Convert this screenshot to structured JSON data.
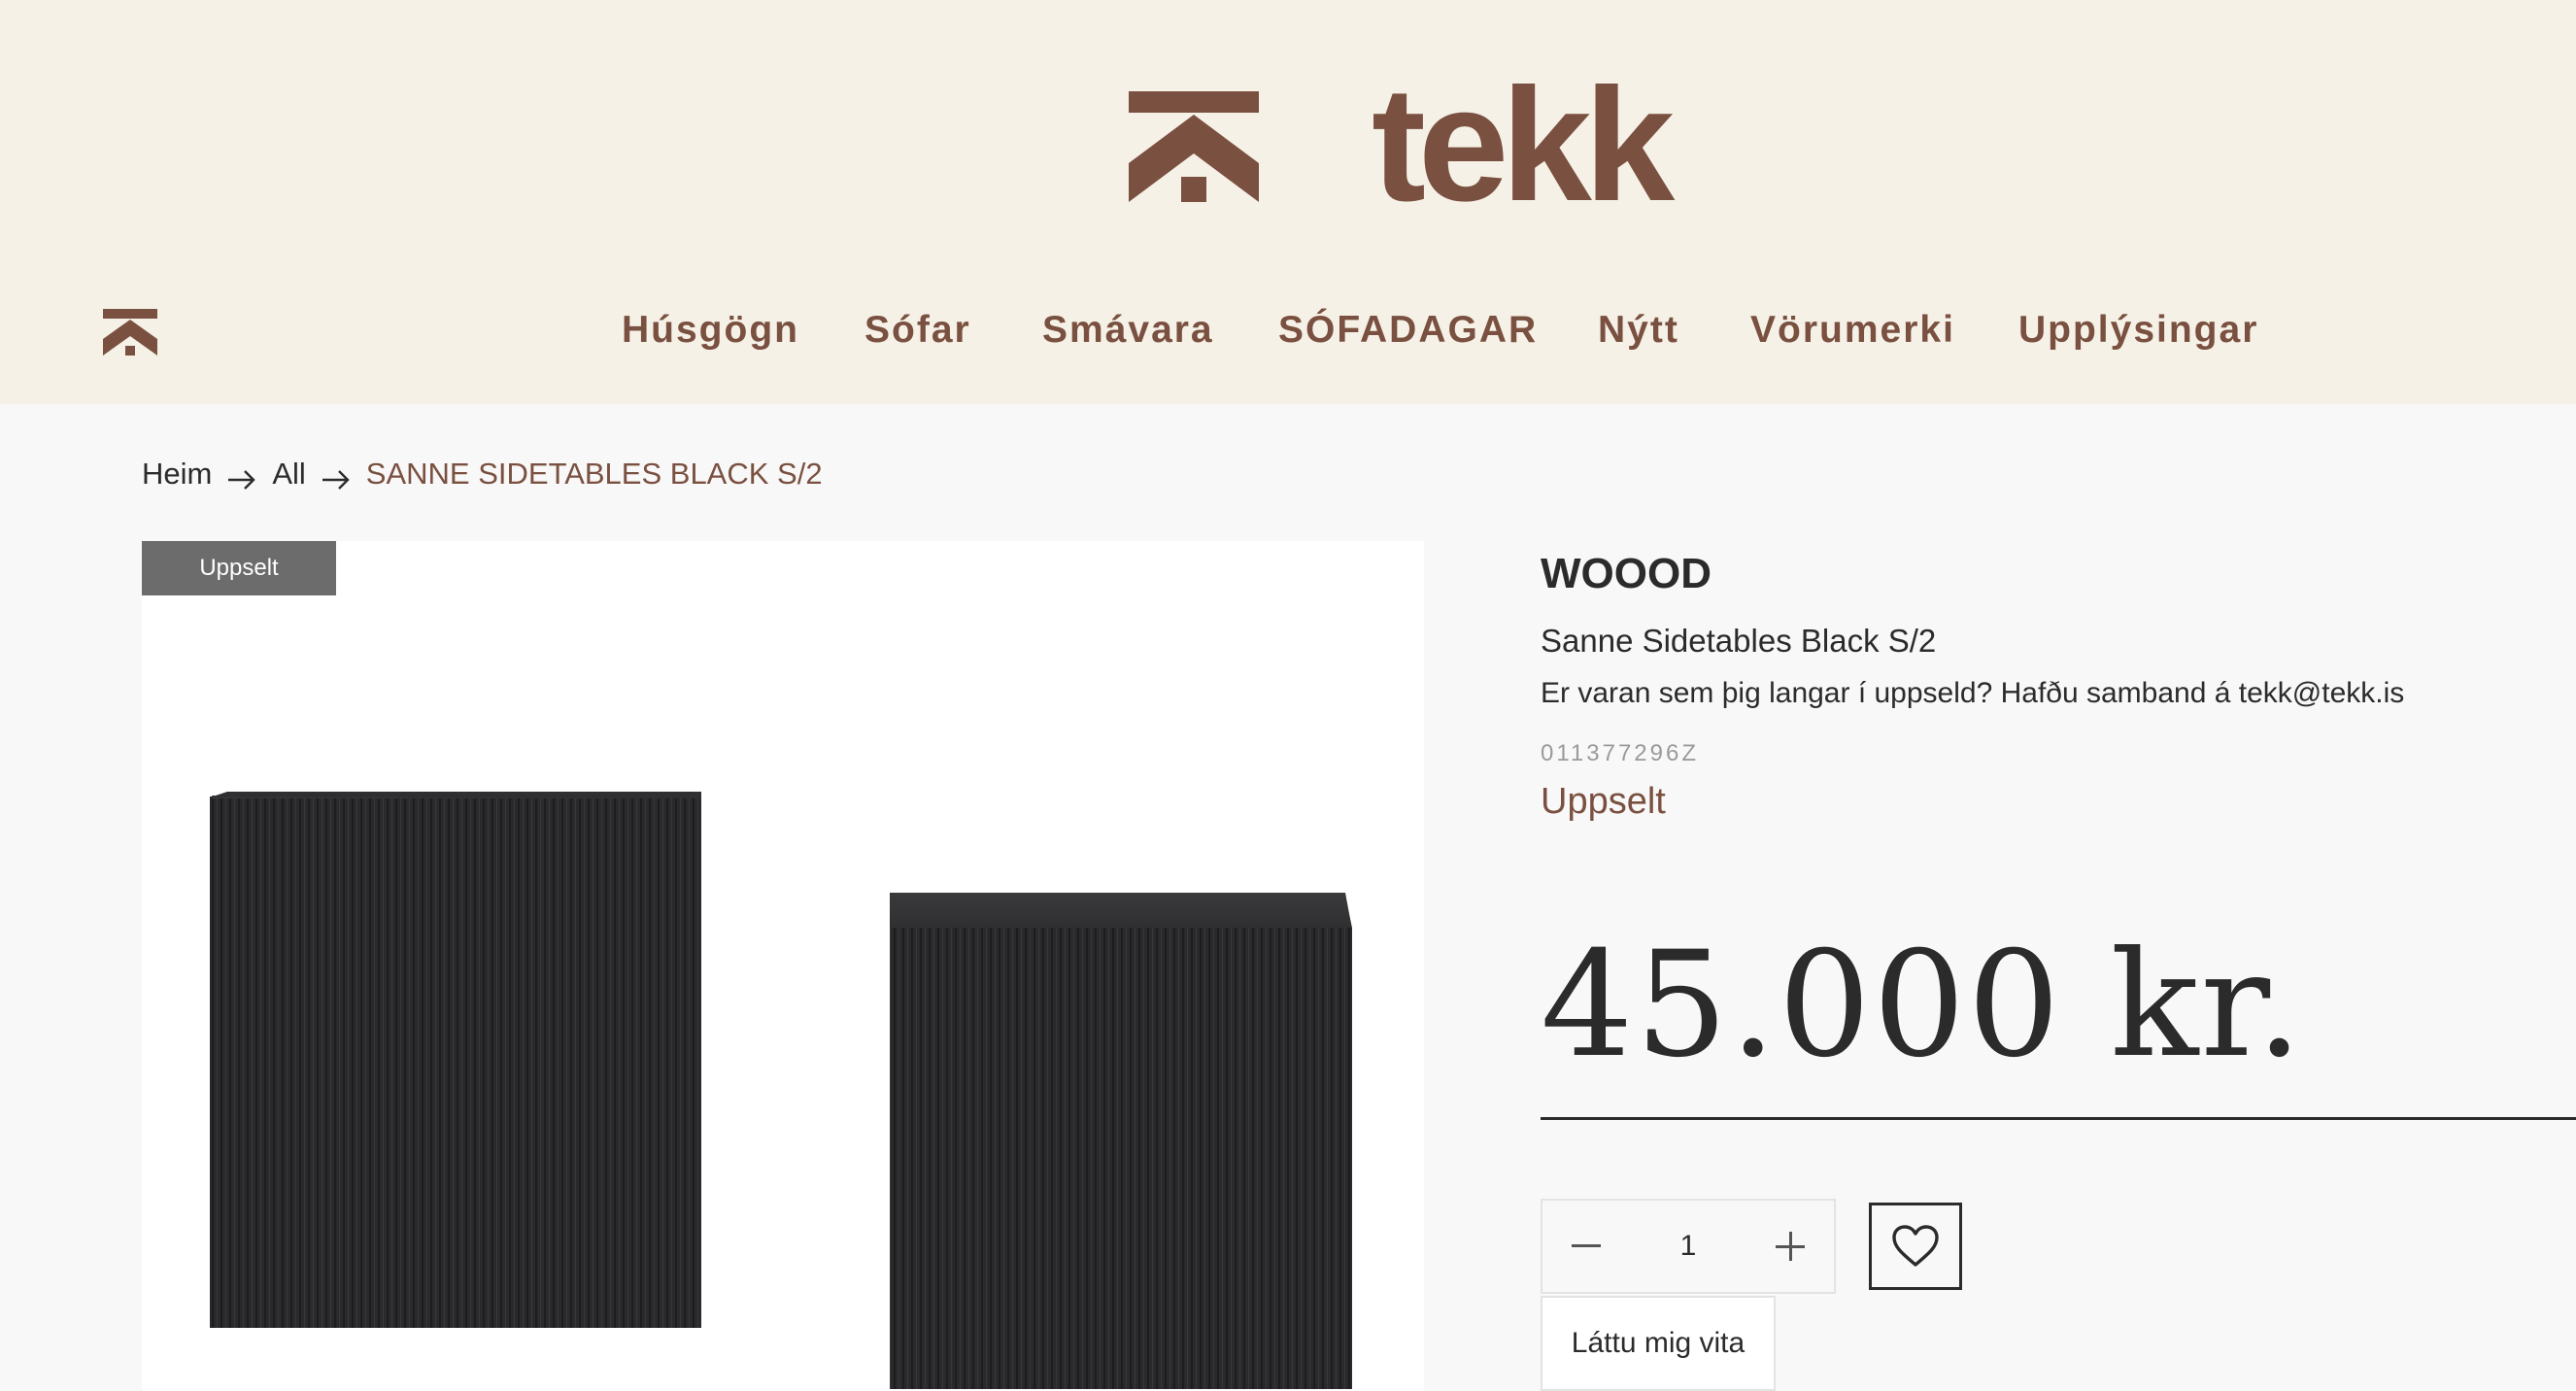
{
  "header": {
    "logo_text": "tekk",
    "nav": [
      {
        "label": "Húsgögn"
      },
      {
        "label": "Sófar"
      },
      {
        "label": "Smávara"
      },
      {
        "label": "SÓFADAGAR"
      },
      {
        "label": "Nýtt"
      },
      {
        "label": "Vörumerki"
      },
      {
        "label": "Upplýsingar"
      }
    ]
  },
  "breadcrumb": {
    "home": "Heim",
    "all": "All",
    "current": "SANNE SIDETABLES BLACK S/2"
  },
  "gallery": {
    "badge": "Uppselt"
  },
  "product": {
    "brand": "WOOOD",
    "title": "Sanne Sidetables Black S/2",
    "note": "Er varan sem þig langar í uppseld? Hafðu samband á tekk@tekk.is",
    "sku": "011377296Z",
    "status": "Uppselt",
    "price": "45.000 kr."
  },
  "cart": {
    "quantity": "1",
    "notify_label": "Láttu mig vita"
  },
  "colors": {
    "brand_brown": "#7a5040",
    "header_bg": "#f6f1e7",
    "page_bg": "#f8f8f8",
    "badge_bg": "#6c6c6c"
  },
  "icons": {
    "quantity_decrease": "minus-icon",
    "quantity_increase": "plus-icon",
    "wishlist": "heart-icon",
    "breadcrumb_separator": "arrow-right-icon"
  }
}
